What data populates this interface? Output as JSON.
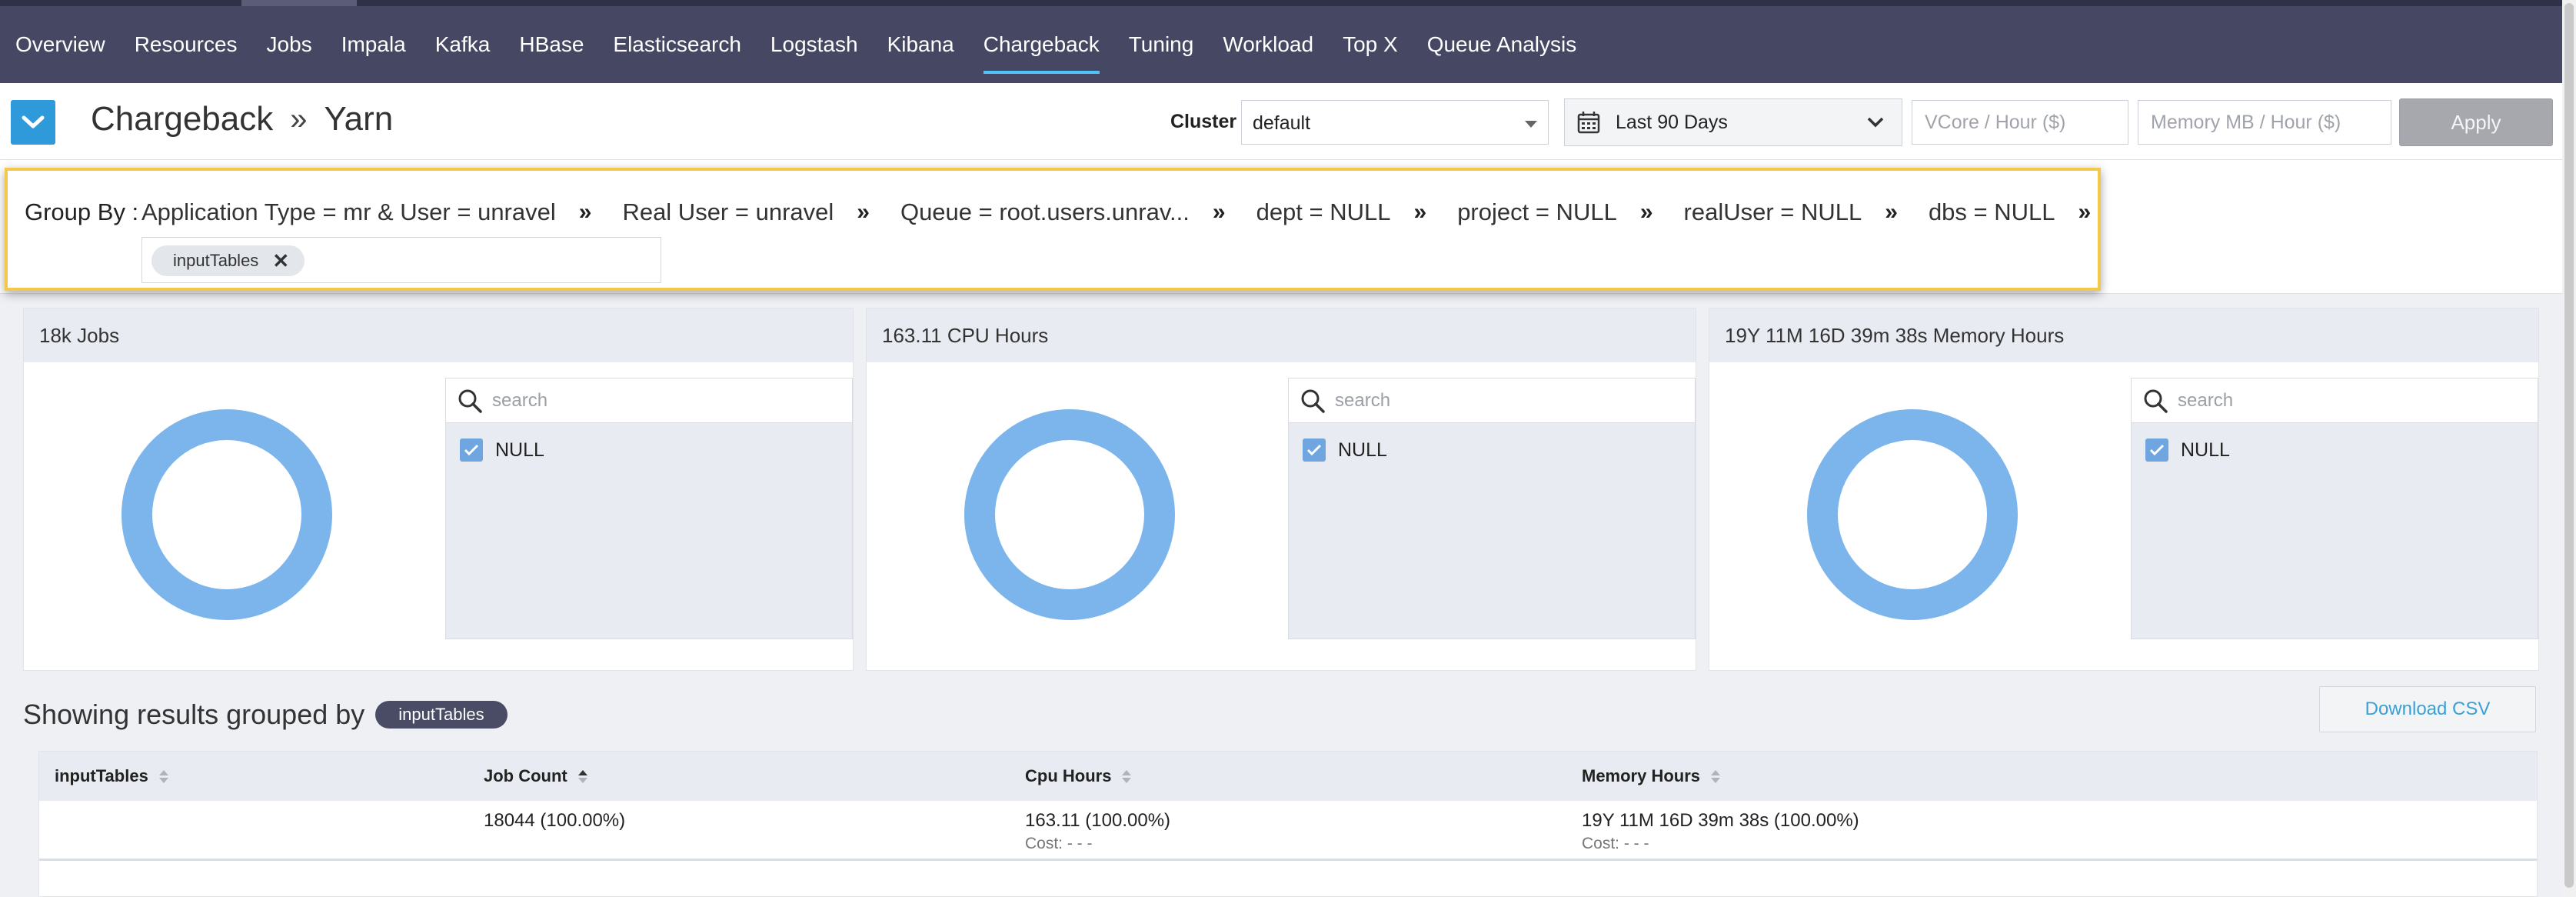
{
  "nav": {
    "items": [
      "Overview",
      "Resources",
      "Jobs",
      "Impala",
      "Kafka",
      "HBase",
      "Elasticsearch",
      "Logstash",
      "Kibana",
      "Chargeback",
      "Tuning",
      "Workload",
      "Top X",
      "Queue Analysis"
    ],
    "active": "Chargeback",
    "accent_color": "#4fc3f7"
  },
  "header": {
    "title": "Chargeback",
    "separator": "»",
    "subtitle": "Yarn",
    "cluster_label": "Cluster",
    "cluster_value": "default",
    "date_range": "Last 90 Days",
    "vcore_placeholder": "VCore / Hour ($)",
    "memory_placeholder": "Memory MB / Hour ($)",
    "apply_label": "Apply"
  },
  "group_by": {
    "label": "Group By :",
    "crumbs": [
      "Application Type = mr & User = unravel",
      "Real User = unravel",
      "Queue = root.users.unrav...",
      "dept = NULL",
      "project = NULL",
      "realUser = NULL",
      "dbs = NULL"
    ],
    "arrow": "»",
    "chip_label": "inputTables",
    "highlight_color": "#f2c94c"
  },
  "cards": [
    {
      "title": "18k Jobs",
      "search_placeholder": "search",
      "legend_item": "NULL"
    },
    {
      "title": "163.11 CPU Hours",
      "search_placeholder": "search",
      "legend_item": "NULL"
    },
    {
      "title": "19Y 11M 16D 39m 38s Memory Hours",
      "search_placeholder": "search",
      "legend_item": "NULL"
    }
  ],
  "donut_color": "#7cb5ec",
  "results": {
    "title": "Showing results grouped by",
    "pill": "inputTables",
    "download_label": "Download CSV",
    "columns": [
      "inputTables",
      "Job Count",
      "Cpu Hours",
      "Memory Hours"
    ],
    "rows": [
      {
        "input_tables": "",
        "job_count": "18044 (100.00%)",
        "cpu_hours": "163.11 (100.00%)",
        "cpu_cost": "Cost: - - -",
        "memory_hours": "19Y 11M 16D 39m 38s (100.00%)",
        "memory_cost": "Cost: - - -"
      }
    ]
  }
}
